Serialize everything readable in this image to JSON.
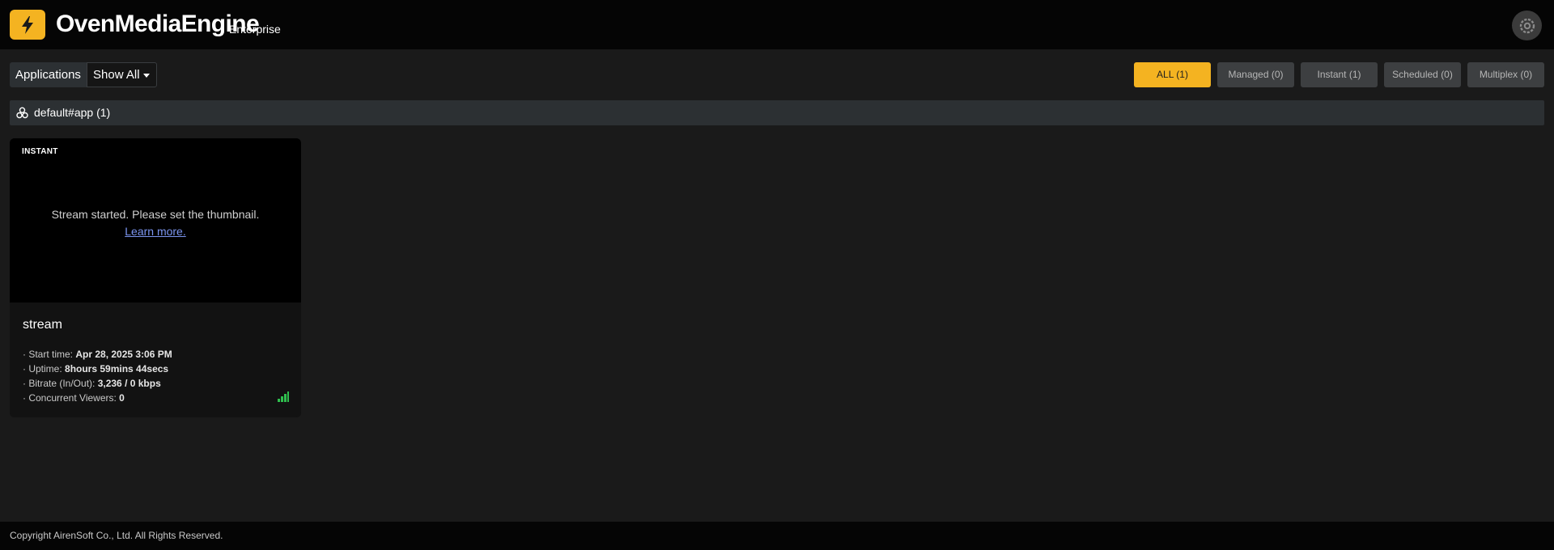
{
  "header": {
    "brand_title": "OvenMediaEngine",
    "brand_subtitle": "Enterprise",
    "logo_icon": "lightning-bolt-icon",
    "settings_icon": "gear-icon",
    "accent_color": "#f4b321"
  },
  "toolbar": {
    "applications_label": "Applications",
    "app_filter_selected": "Show All",
    "filters": [
      {
        "label": "ALL (1)",
        "active": true
      },
      {
        "label": "Managed (0)",
        "active": false
      },
      {
        "label": "Instant (1)",
        "active": false
      },
      {
        "label": "Scheduled (0)",
        "active": false
      },
      {
        "label": "Multiplex (0)",
        "active": false
      }
    ]
  },
  "group": {
    "label": "default#app (1)",
    "icon": "cluster-icon"
  },
  "stream_card": {
    "badge": "INSTANT",
    "thumbnail_message": "Stream started. Please set the thumbnail.",
    "learn_more": "Learn more.",
    "name": "stream",
    "details": [
      {
        "label": "· Start time: ",
        "value": "Apr 28, 2025 3:06 PM"
      },
      {
        "label": "· Uptime: ",
        "value": "8hours 59mins 44secs"
      },
      {
        "label": "· Bitrate (In/Out): ",
        "value": "3,236 / 0 kbps"
      },
      {
        "label": "· Concurrent Viewers: ",
        "value": "0"
      }
    ],
    "signal_icon": "signal-bars-icon",
    "signal_color": "#2fbf4e"
  },
  "footer": {
    "copyright": "Copyright AirenSoft Co., Ltd. All Rights Reserved."
  }
}
